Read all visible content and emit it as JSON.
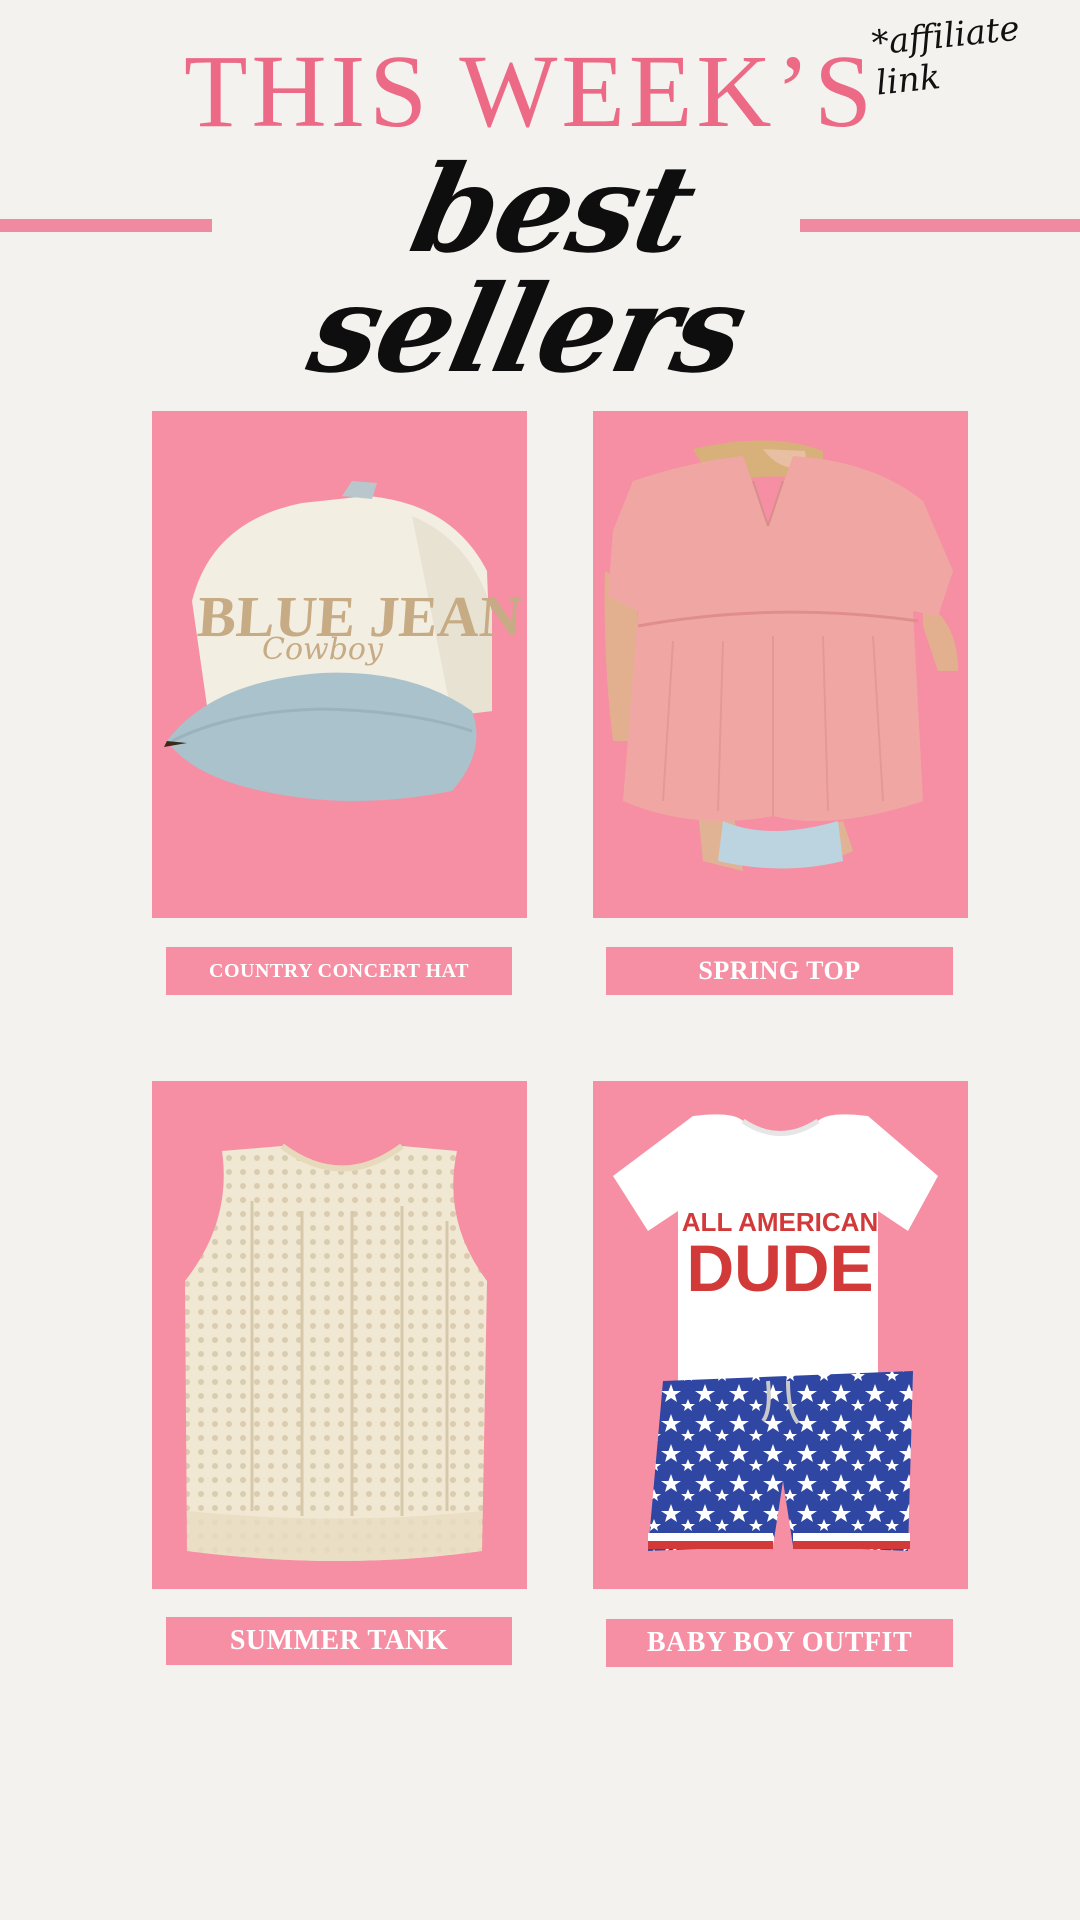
{
  "header": {
    "title_top": "THIS WEEK’S",
    "title_script": "best sellers",
    "note": "*affiliate link"
  },
  "products": [
    {
      "label": "COUNTRY CONCERT HAT",
      "image_icon": "trucker-hat-image",
      "print_line1": "BLUE JEAN",
      "print_line2": "Cowboy"
    },
    {
      "label": "SPRING TOP",
      "image_icon": "peplum-top-image"
    },
    {
      "label": "SUMMER TANK",
      "image_icon": "crochet-tank-image"
    },
    {
      "label": "BABY BOY OUTFIT",
      "image_icon": "boy-outfit-image",
      "print_line1": "ALL AMERICAN",
      "print_line2": "DUDE"
    }
  ],
  "colors": {
    "background": "#f4f2ee",
    "pink_title": "#ec6a86",
    "card_pink": "#f68fa3",
    "script_black": "#0e0e0e"
  }
}
